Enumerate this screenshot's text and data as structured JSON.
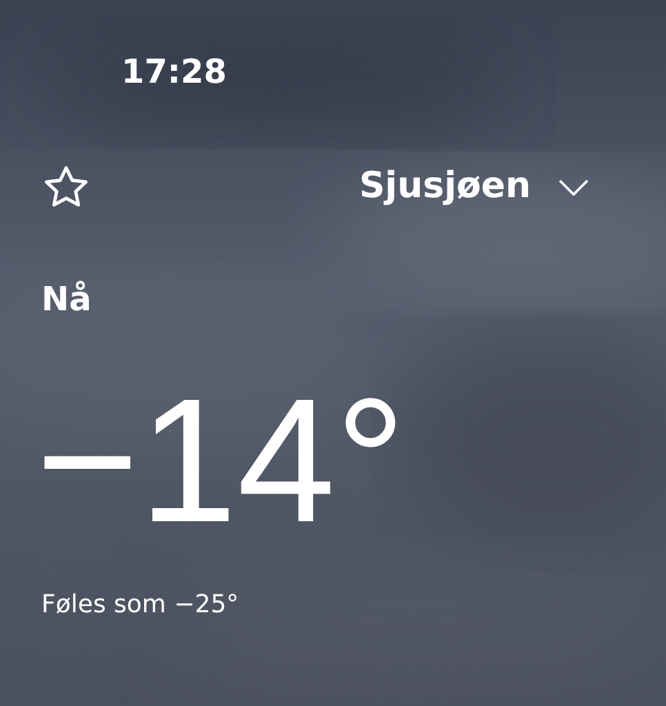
{
  "status_bar": {
    "time": "17:28"
  },
  "header": {
    "favorite": false,
    "location": "Sjusjøen"
  },
  "now": {
    "label": "Nå",
    "temperature": "−14°",
    "feels_like": "Føles som −25°"
  }
}
